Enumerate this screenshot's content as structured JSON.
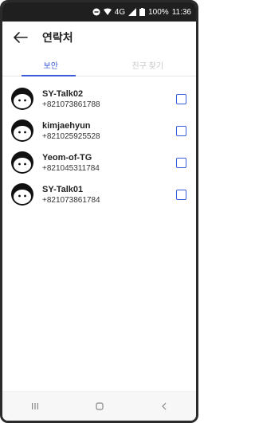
{
  "status_bar": {
    "signal_type": "4G",
    "battery_percent": "100%",
    "time": "11:36"
  },
  "header": {
    "title": "연락처",
    "back_icon": "arrow-left-icon"
  },
  "tabs": [
    {
      "label": "보안",
      "active": true
    },
    {
      "label": "친구 찾기",
      "active": false
    }
  ],
  "contacts": [
    {
      "name": "SY-Talk02",
      "number": "+821073861788",
      "checked": false
    },
    {
      "name": "kimjaehyun",
      "number": "+821025925528",
      "checked": false
    },
    {
      "name": "Yeom-of-TG",
      "number": "+821045311784",
      "checked": false
    },
    {
      "name": "SY-Talk01",
      "number": "+821073861784",
      "checked": false
    }
  ],
  "bottom_nav": {
    "recent_icon": "recent-apps-icon",
    "home_icon": "home-icon",
    "back_icon": "back-chevron-icon"
  },
  "colors": {
    "accent": "#3b5bdb",
    "status_bar_bg": "#1f1f1f",
    "inactive_tab": "#c7c7c7"
  }
}
